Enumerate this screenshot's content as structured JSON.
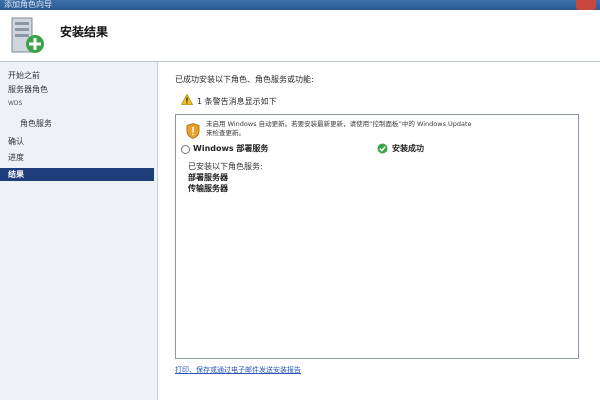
{
  "window": {
    "title": "添加角色向导"
  },
  "header": {
    "title": "安装结果"
  },
  "leftnav": {
    "items": [
      {
        "label": "开始之前",
        "level": 0,
        "active": false
      },
      {
        "label": "服务器角色",
        "level": 0,
        "active": false
      },
      {
        "label": "WDS",
        "level": 0,
        "active": false
      },
      {
        "label": "角色服务",
        "level": 1,
        "active": false
      },
      {
        "label": "确认",
        "level": 0,
        "active": false
      },
      {
        "label": "进度",
        "level": 0,
        "active": false
      },
      {
        "label": "结果",
        "level": 0,
        "active": true
      }
    ]
  },
  "content": {
    "summary": "已成功安装以下角色、角色服务或功能:",
    "warning_line": "1 条警告消息显示如下",
    "notice_line1": "未启用 Windows 自动更新。若要安装最新更新，请使用“控制面板”中的 Windows Update",
    "notice_line2": "来检查更新。",
    "role": {
      "name": "Windows 部署服务",
      "status": "安装成功"
    },
    "details": {
      "intro": "已安装以下角色服务:",
      "items": [
        "部署服务器",
        "传输服务器"
      ]
    },
    "footer_link": "打印、保存或通过电子邮件发送安装报告"
  },
  "colors": {
    "nav_active": "#1e3d7a",
    "titlebar": "#2a5a93",
    "link": "#2a56b8"
  }
}
